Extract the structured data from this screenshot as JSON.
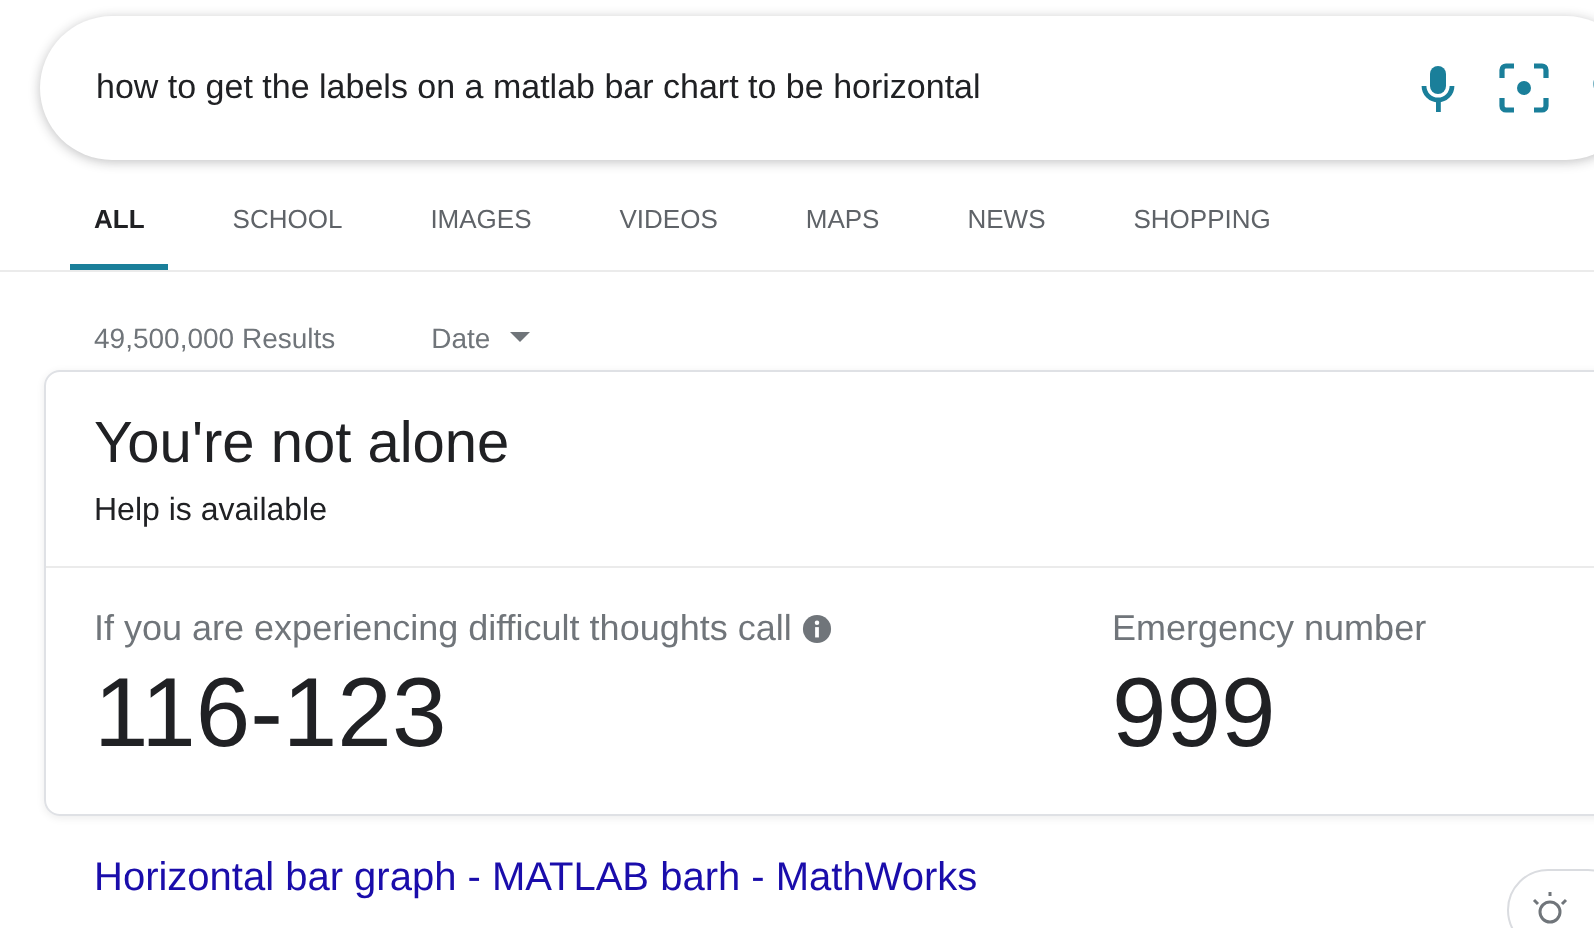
{
  "search": {
    "value": "how to get the labels on a matlab bar chart to be horizontal"
  },
  "tabs": [
    {
      "label": "ALL",
      "selected": true
    },
    {
      "label": "SCHOOL",
      "selected": false
    },
    {
      "label": "IMAGES",
      "selected": false
    },
    {
      "label": "VIDEOS",
      "selected": false
    },
    {
      "label": "MAPS",
      "selected": false
    },
    {
      "label": "NEWS",
      "selected": false
    },
    {
      "label": "SHOPPING",
      "selected": false
    }
  ],
  "results_count": "49,500,000 Results",
  "date_filter": "Date",
  "help_card": {
    "title": "You're not alone",
    "subtitle": "Help is available",
    "contacts": [
      {
        "label": "If you are experiencing difficult thoughts call",
        "info": true,
        "number": "116-123"
      },
      {
        "label": "Emergency number",
        "info": false,
        "number": "999"
      }
    ]
  },
  "first_result": {
    "title": "Horizontal bar graph - MATLAB barh - MathWorks"
  }
}
